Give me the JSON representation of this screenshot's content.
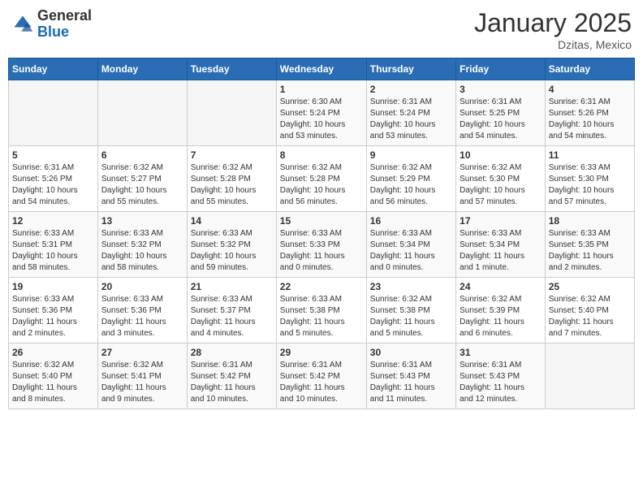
{
  "header": {
    "logo_general": "General",
    "logo_blue": "Blue",
    "month_title": "January 2025",
    "location": "Dzitas, Mexico"
  },
  "days_of_week": [
    "Sunday",
    "Monday",
    "Tuesday",
    "Wednesday",
    "Thursday",
    "Friday",
    "Saturday"
  ],
  "weeks": [
    [
      {
        "day": "",
        "info": ""
      },
      {
        "day": "",
        "info": ""
      },
      {
        "day": "",
        "info": ""
      },
      {
        "day": "1",
        "info": "Sunrise: 6:30 AM\nSunset: 5:24 PM\nDaylight: 10 hours\nand 53 minutes."
      },
      {
        "day": "2",
        "info": "Sunrise: 6:31 AM\nSunset: 5:24 PM\nDaylight: 10 hours\nand 53 minutes."
      },
      {
        "day": "3",
        "info": "Sunrise: 6:31 AM\nSunset: 5:25 PM\nDaylight: 10 hours\nand 54 minutes."
      },
      {
        "day": "4",
        "info": "Sunrise: 6:31 AM\nSunset: 5:26 PM\nDaylight: 10 hours\nand 54 minutes."
      }
    ],
    [
      {
        "day": "5",
        "info": "Sunrise: 6:31 AM\nSunset: 5:26 PM\nDaylight: 10 hours\nand 54 minutes."
      },
      {
        "day": "6",
        "info": "Sunrise: 6:32 AM\nSunset: 5:27 PM\nDaylight: 10 hours\nand 55 minutes."
      },
      {
        "day": "7",
        "info": "Sunrise: 6:32 AM\nSunset: 5:28 PM\nDaylight: 10 hours\nand 55 minutes."
      },
      {
        "day": "8",
        "info": "Sunrise: 6:32 AM\nSunset: 5:28 PM\nDaylight: 10 hours\nand 56 minutes."
      },
      {
        "day": "9",
        "info": "Sunrise: 6:32 AM\nSunset: 5:29 PM\nDaylight: 10 hours\nand 56 minutes."
      },
      {
        "day": "10",
        "info": "Sunrise: 6:32 AM\nSunset: 5:30 PM\nDaylight: 10 hours\nand 57 minutes."
      },
      {
        "day": "11",
        "info": "Sunrise: 6:33 AM\nSunset: 5:30 PM\nDaylight: 10 hours\nand 57 minutes."
      }
    ],
    [
      {
        "day": "12",
        "info": "Sunrise: 6:33 AM\nSunset: 5:31 PM\nDaylight: 10 hours\nand 58 minutes."
      },
      {
        "day": "13",
        "info": "Sunrise: 6:33 AM\nSunset: 5:32 PM\nDaylight: 10 hours\nand 58 minutes."
      },
      {
        "day": "14",
        "info": "Sunrise: 6:33 AM\nSunset: 5:32 PM\nDaylight: 10 hours\nand 59 minutes."
      },
      {
        "day": "15",
        "info": "Sunrise: 6:33 AM\nSunset: 5:33 PM\nDaylight: 11 hours\nand 0 minutes."
      },
      {
        "day": "16",
        "info": "Sunrise: 6:33 AM\nSunset: 5:34 PM\nDaylight: 11 hours\nand 0 minutes."
      },
      {
        "day": "17",
        "info": "Sunrise: 6:33 AM\nSunset: 5:34 PM\nDaylight: 11 hours\nand 1 minute."
      },
      {
        "day": "18",
        "info": "Sunrise: 6:33 AM\nSunset: 5:35 PM\nDaylight: 11 hours\nand 2 minutes."
      }
    ],
    [
      {
        "day": "19",
        "info": "Sunrise: 6:33 AM\nSunset: 5:36 PM\nDaylight: 11 hours\nand 2 minutes."
      },
      {
        "day": "20",
        "info": "Sunrise: 6:33 AM\nSunset: 5:36 PM\nDaylight: 11 hours\nand 3 minutes."
      },
      {
        "day": "21",
        "info": "Sunrise: 6:33 AM\nSunset: 5:37 PM\nDaylight: 11 hours\nand 4 minutes."
      },
      {
        "day": "22",
        "info": "Sunrise: 6:33 AM\nSunset: 5:38 PM\nDaylight: 11 hours\nand 5 minutes."
      },
      {
        "day": "23",
        "info": "Sunrise: 6:32 AM\nSunset: 5:38 PM\nDaylight: 11 hours\nand 5 minutes."
      },
      {
        "day": "24",
        "info": "Sunrise: 6:32 AM\nSunset: 5:39 PM\nDaylight: 11 hours\nand 6 minutes."
      },
      {
        "day": "25",
        "info": "Sunrise: 6:32 AM\nSunset: 5:40 PM\nDaylight: 11 hours\nand 7 minutes."
      }
    ],
    [
      {
        "day": "26",
        "info": "Sunrise: 6:32 AM\nSunset: 5:40 PM\nDaylight: 11 hours\nand 8 minutes."
      },
      {
        "day": "27",
        "info": "Sunrise: 6:32 AM\nSunset: 5:41 PM\nDaylight: 11 hours\nand 9 minutes."
      },
      {
        "day": "28",
        "info": "Sunrise: 6:31 AM\nSunset: 5:42 PM\nDaylight: 11 hours\nand 10 minutes."
      },
      {
        "day": "29",
        "info": "Sunrise: 6:31 AM\nSunset: 5:42 PM\nDaylight: 11 hours\nand 10 minutes."
      },
      {
        "day": "30",
        "info": "Sunrise: 6:31 AM\nSunset: 5:43 PM\nDaylight: 11 hours\nand 11 minutes."
      },
      {
        "day": "31",
        "info": "Sunrise: 6:31 AM\nSunset: 5:43 PM\nDaylight: 11 hours\nand 12 minutes."
      },
      {
        "day": "",
        "info": ""
      }
    ]
  ]
}
